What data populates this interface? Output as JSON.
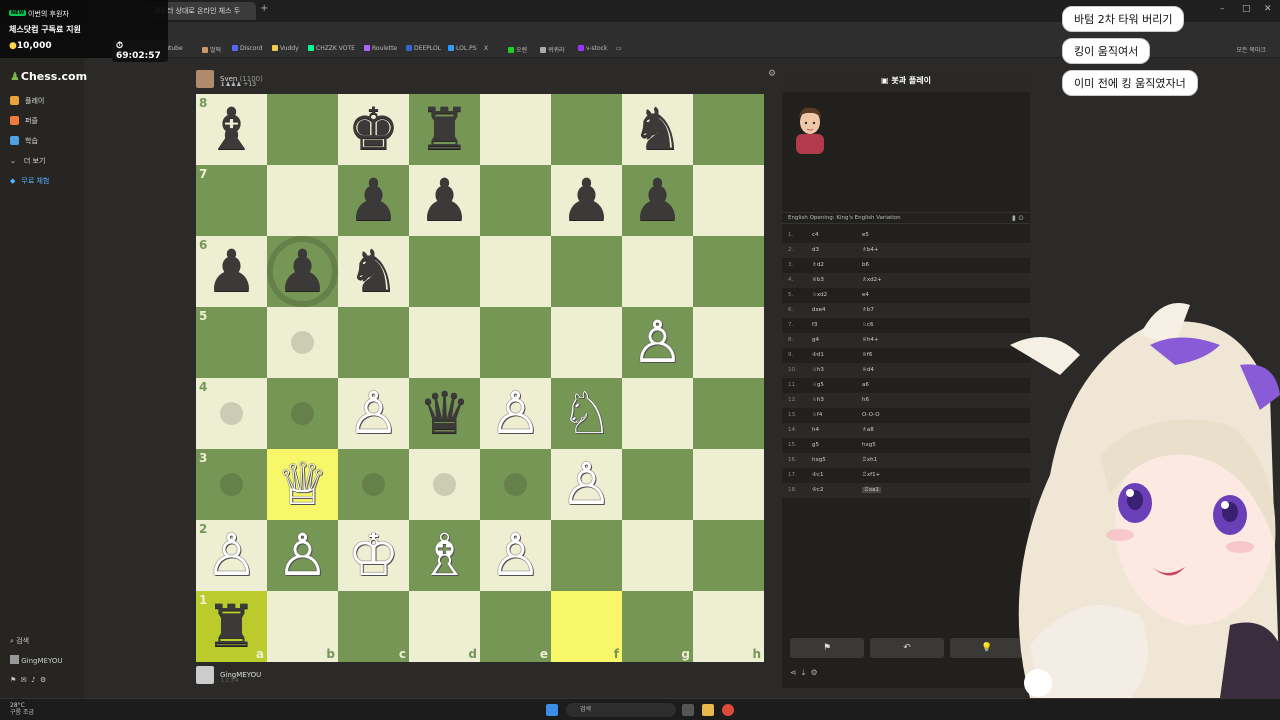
{
  "overlay": {
    "badge": "NEW",
    "line1": "이번의 후원자",
    "line2": "체스닷컴 구독료 지원",
    "coin": "10,000",
    "timer": "69:02:57"
  },
  "browser": {
    "tabs": [
      "",
      "",
      "컴퓨터 상대로 온라인 체스 두"
    ],
    "bookmarks": [
      "youtube",
      "벌떡",
      "Discord",
      "Vuddy",
      "CHZZK VOTE",
      "Roulette",
      "DEEPLOL",
      "LOL.PS",
      "X",
      "오렌",
      "퀴퀴라",
      "v-stock"
    ],
    "all_bookmarks": "모든 북마크"
  },
  "sidebar": {
    "logo": "Chess.com",
    "items": [
      {
        "label": "플레이",
        "color": "#e9a33b"
      },
      {
        "label": "퍼즐",
        "color": "#ef7a3a"
      },
      {
        "label": "학습",
        "color": "#4fa3e3"
      },
      {
        "label": "더 보기",
        "color": ""
      },
      {
        "label": "무료 체험",
        "color": "#4fb7ff"
      }
    ],
    "search": "검색",
    "user": "GingMEYOU"
  },
  "top_player": {
    "name": "Sven",
    "rating": "(1100)",
    "captured": "♝♟♟♟ +13"
  },
  "bottom_player": {
    "name": "GingMEYOU",
    "sub": "1 2 3 4"
  },
  "board": {
    "ranks": [
      "8",
      "7",
      "6",
      "5",
      "4",
      "3",
      "2",
      "1"
    ],
    "files": [
      "a",
      "b",
      "c",
      "d",
      "e",
      "f",
      "g",
      "h"
    ],
    "light": "#eeeed2",
    "dark": "#769656",
    "highlight": "#f7f769",
    "pieces": [
      {
        "sq": "a8",
        "glyph": "♝",
        "color": "b"
      },
      {
        "sq": "c8",
        "glyph": "♚",
        "color": "b"
      },
      {
        "sq": "d8",
        "glyph": "♜",
        "color": "b"
      },
      {
        "sq": "g8",
        "glyph": "♞",
        "color": "b"
      },
      {
        "sq": "c7",
        "glyph": "♟",
        "color": "b"
      },
      {
        "sq": "d7",
        "glyph": "♟",
        "color": "b"
      },
      {
        "sq": "f7",
        "glyph": "♟",
        "color": "b"
      },
      {
        "sq": "g7",
        "glyph": "♟",
        "color": "b"
      },
      {
        "sq": "a6",
        "glyph": "♟",
        "color": "b"
      },
      {
        "sq": "b6",
        "glyph": "♟",
        "color": "b"
      },
      {
        "sq": "c6",
        "glyph": "♞",
        "color": "b"
      },
      {
        "sq": "g5",
        "glyph": "♙",
        "color": "w"
      },
      {
        "sq": "c4",
        "glyph": "♙",
        "color": "w"
      },
      {
        "sq": "d4",
        "glyph": "♛",
        "color": "b"
      },
      {
        "sq": "e4",
        "glyph": "♙",
        "color": "w"
      },
      {
        "sq": "f4",
        "glyph": "♘",
        "color": "w"
      },
      {
        "sq": "b3",
        "glyph": "♕",
        "color": "w"
      },
      {
        "sq": "f3",
        "glyph": "♙",
        "color": "w"
      },
      {
        "sq": "a2",
        "glyph": "♙",
        "color": "w"
      },
      {
        "sq": "b2",
        "glyph": "♙",
        "color": "w"
      },
      {
        "sq": "c2",
        "glyph": "♔",
        "color": "w"
      },
      {
        "sq": "d2",
        "glyph": "♗",
        "color": "w"
      },
      {
        "sq": "e2",
        "glyph": "♙",
        "color": "w"
      },
      {
        "sq": "a1",
        "glyph": "♜",
        "color": "b"
      }
    ],
    "highlights": [
      "b3",
      "a1",
      "f1"
    ],
    "hints": [
      "b5",
      "a4",
      "b4",
      "a3",
      "c3",
      "d3",
      "e3"
    ],
    "capture_hints": [
      "b6"
    ]
  },
  "panel": {
    "title": "봇과 플레이",
    "opening": "English Opening: King's English Variation",
    "moves": [
      {
        "n": "1.",
        "w": "c4",
        "b": "e5"
      },
      {
        "n": "2.",
        "w": "d3",
        "b": "♗b4+"
      },
      {
        "n": "3.",
        "w": "♗d2",
        "b": "b6"
      },
      {
        "n": "4.",
        "w": "♕b3",
        "b": "♗xd2+"
      },
      {
        "n": "5.",
        "w": "♘xd2",
        "b": "e4"
      },
      {
        "n": "6.",
        "w": "dxe4",
        "b": "♗b7"
      },
      {
        "n": "7.",
        "w": "f3",
        "b": "♘c6"
      },
      {
        "n": "8.",
        "w": "g4",
        "b": "♕h4+"
      },
      {
        "n": "9.",
        "w": "♔d1",
        "b": "♕f6"
      },
      {
        "n": "10.",
        "w": "♘h3",
        "b": "♕d4"
      },
      {
        "n": "11.",
        "w": "♘g5",
        "b": "a6"
      },
      {
        "n": "12.",
        "w": "♘h3",
        "b": "h6"
      },
      {
        "n": "13.",
        "w": "♘f4",
        "b": "O-O-O"
      },
      {
        "n": "14.",
        "w": "h4",
        "b": "♗a8"
      },
      {
        "n": "15.",
        "w": "g5",
        "b": "hxg5"
      },
      {
        "n": "16.",
        "w": "hxg5",
        "b": "♖xh1"
      },
      {
        "n": "17.",
        "w": "♔c1",
        "b": "♖xf1+"
      },
      {
        "n": "18.",
        "w": "♔c2",
        "b": "♖xa1"
      }
    ],
    "buttons": [
      "⚑",
      "↶",
      "💡"
    ]
  },
  "chat": [
    "바텀 2차 타워 버리기",
    "킹이 움직여서",
    "이미 전에 킹 움직였자너"
  ],
  "taskbar": {
    "weather_temp": "28°C",
    "weather_desc": "구름 조금",
    "search": "검색"
  }
}
